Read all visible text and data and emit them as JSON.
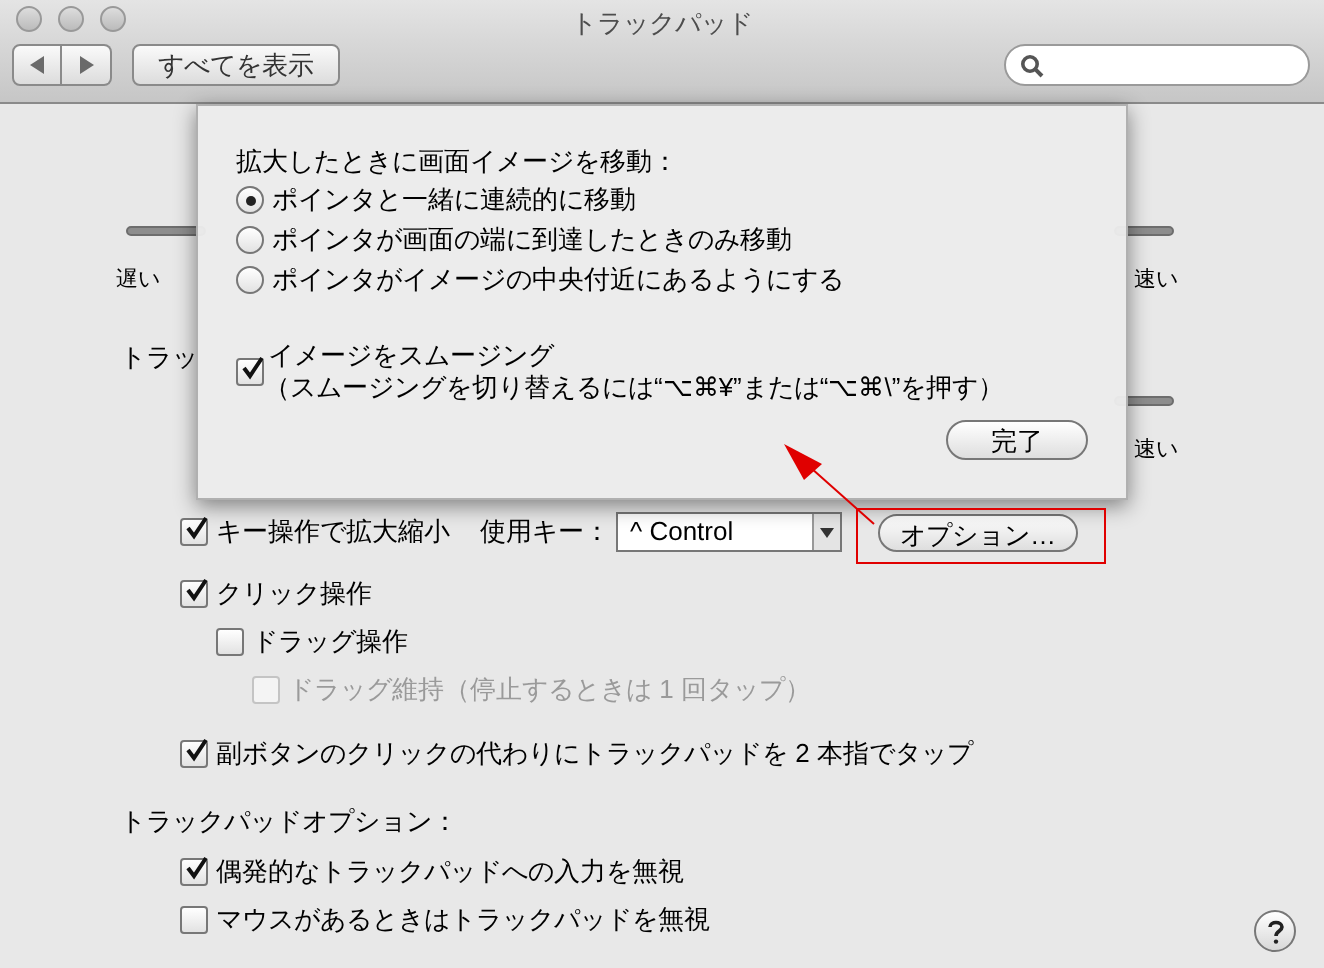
{
  "window": {
    "title": "トラックパッド"
  },
  "toolbar": {
    "show_all_button": "すべてを表示"
  },
  "background": {
    "top_scale": {
      "slow": "遅い",
      "fast": "速い"
    },
    "section_heading": "トラッ",
    "lower_scale": {
      "fast": "速い"
    }
  },
  "zoom_row": {
    "label": "キー操作で拡大縮小",
    "checked": true,
    "key_label": "使用キー：",
    "key_popup": "^ Control",
    "options_button": "オプション…"
  },
  "click_options": [
    {
      "label": "クリック操作",
      "checked": true,
      "disabled": false,
      "children": [
        {
          "label": "ドラッグ操作",
          "checked": false,
          "disabled": false,
          "children": [
            {
              "label": "ドラッグ維持（停止するときは 1 回タップ）",
              "checked": false,
              "disabled": true
            }
          ]
        }
      ]
    },
    {
      "label": "副ボタンのクリックの代わりにトラックパッドを 2 本指でタップ",
      "checked": true,
      "disabled": false
    }
  ],
  "trackpad_options": {
    "heading": "トラックパッドオプション：",
    "items": [
      {
        "label": "偶発的なトラックパッドへの入力を無視",
        "checked": true
      },
      {
        "label": "マウスがあるときはトラックパッドを無視",
        "checked": false
      }
    ]
  },
  "sheet": {
    "heading": "拡大したときに画面イメージを移動：",
    "move_modes": [
      {
        "label": "ポインタと一緒に連続的に移動",
        "selected": true
      },
      {
        "label": "ポインタが画面の端に到達したときのみ移動",
        "selected": false
      },
      {
        "label": "ポインタがイメージの中央付近にあるようにする",
        "selected": false
      }
    ],
    "smoothing": {
      "label": "イメージをスムージング",
      "hint": "（スムージングを切り替えるには“⌥⌘¥”または“⌥⌘\\”を押す）",
      "checked": true
    },
    "done_button": "完了"
  }
}
